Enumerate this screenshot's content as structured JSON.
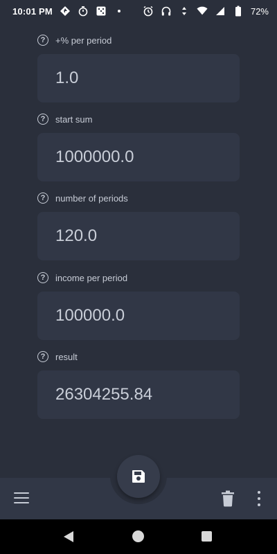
{
  "status_bar": {
    "time": "10:01 PM",
    "battery": "72%",
    "left_icons": [
      "navigation-arrow-icon",
      "stopwatch-icon",
      "dice-icon",
      "dot-icon"
    ],
    "right_icons": [
      "alarm-icon",
      "headphones-icon",
      "wifi-icon",
      "signal-icon",
      "battery-icon"
    ]
  },
  "fields": [
    {
      "label": "+% per period",
      "value": "1.0"
    },
    {
      "label": "start sum",
      "value": "1000000.0"
    },
    {
      "label": "number of periods",
      "value": "120.0"
    },
    {
      "label": "income per period",
      "value": "100000.0"
    },
    {
      "label": "result",
      "value": "26304255.84"
    }
  ],
  "bottom_bar": {
    "menu_icon": "hamburger-menu-icon",
    "fab_icon": "save-icon",
    "delete_icon": "trash-icon",
    "more_icon": "more-vert-icon"
  },
  "nav_bar": {
    "icons": [
      "back-icon",
      "home-icon",
      "recents-icon"
    ]
  },
  "colors": {
    "background": "#2a2f3b",
    "field_background": "#313746",
    "text": "#c7ccd6"
  }
}
